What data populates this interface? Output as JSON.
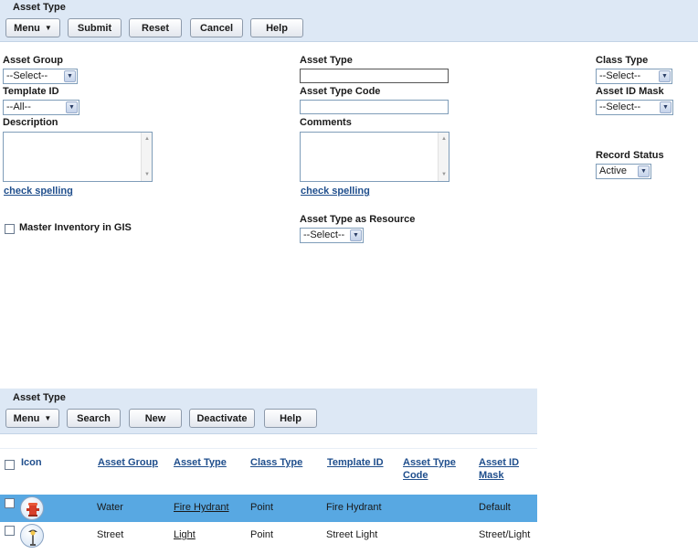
{
  "top_panel": {
    "title": "Asset Type",
    "buttons": {
      "menu": "Menu",
      "submit": "Submit",
      "reset": "Reset",
      "cancel": "Cancel",
      "help": "Help"
    }
  },
  "form": {
    "asset_group": {
      "label": "Asset Group",
      "value": "--Select--"
    },
    "template_id": {
      "label": "Template ID",
      "value": "--All--"
    },
    "description": {
      "label": "Description",
      "value": ""
    },
    "check_spelling_1": "check spelling",
    "master_inventory": {
      "label": "Master Inventory in GIS",
      "checked": false
    },
    "asset_type": {
      "label": "Asset Type",
      "value": ""
    },
    "asset_type_code": {
      "label": "Asset Type Code",
      "value": ""
    },
    "comments": {
      "label": "Comments",
      "value": ""
    },
    "check_spelling_2": "check spelling",
    "asset_type_resource": {
      "label": "Asset Type as Resource",
      "value": "--Select--"
    },
    "class_type": {
      "label": "Class Type",
      "value": "--Select--"
    },
    "asset_id_mask": {
      "label": "Asset ID Mask",
      "value": "--Select--"
    },
    "record_status": {
      "label": "Record Status",
      "value": "Active"
    }
  },
  "bottom_panel": {
    "title": "Asset Type",
    "buttons": {
      "menu": "Menu",
      "search": "Search",
      "new": "New",
      "deactivate": "Deactivate",
      "help": "Help"
    }
  },
  "table": {
    "columns": {
      "icon": "Icon",
      "asset_group": "Asset Group",
      "asset_type": "Asset Type",
      "class_type": "Class Type",
      "template_id": "Template ID",
      "asset_type_code_1": "Asset Type",
      "asset_type_code_2": "Code",
      "asset_id_mask_1": "Asset ID",
      "asset_id_mask_2": "Mask"
    },
    "rows": [
      {
        "icon": "fire-hydrant-icon",
        "asset_group": "Water",
        "asset_type": "Fire Hydrant",
        "class_type": "Point",
        "template_id": "Fire Hydrant",
        "asset_type_code": "",
        "asset_id_mask": "Default",
        "selected": true
      },
      {
        "icon": "street-light-icon",
        "asset_group": "Street",
        "asset_type": "Light",
        "class_type": "Point",
        "template_id": "Street Light",
        "asset_type_code": "",
        "asset_id_mask": "Street/Light",
        "selected": false
      }
    ]
  },
  "colors": {
    "panel_bg": "#dde8f5",
    "link": "#1f4e8c",
    "selected_row": "#58a8e2"
  }
}
